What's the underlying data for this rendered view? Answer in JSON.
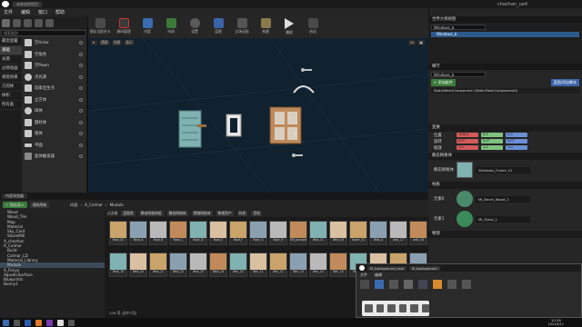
{
  "titlebar": {
    "app_tab": "未命名的项目",
    "user": "chezhan_ue4"
  },
  "menu": [
    "文件",
    "编辑",
    "窗口",
    "帮助"
  ],
  "left_panel": {
    "search_placeholder": "搜索类别",
    "categories": [
      "最近放置",
      "基础",
      "光源",
      "过场动画",
      "视觉效果",
      "几何体",
      "体积",
      "所有类"
    ],
    "items": [
      "空Actor",
      "空角色",
      "空Pawn",
      "点光源",
      "玩家出生点",
      "立方体",
      "球体",
      "圆柱体",
      "锥体",
      "平面",
      "盒体触发器"
    ]
  },
  "toolbar": [
    "保存当前关卡",
    "源码管理",
    "内容",
    "市场",
    "设置",
    "蓝图",
    "过场动画",
    "构建",
    "播放",
    "启动"
  ],
  "viewport": {
    "buttons": [
      "透视",
      "光照",
      "显示"
    ],
    "grid_value": "10"
  },
  "outliner": {
    "title": "世界大纲视图",
    "search": "Windows_b",
    "items": [
      "Windows_b"
    ]
  },
  "details": {
    "title": "细节",
    "actor_name": "Windows_b",
    "add_component": "+ 添加组件",
    "blueprint_button": "蓝图/添加脚本",
    "component": "StaticMeshComponent (StaticMeshComponent0)",
    "sections": {
      "transform": "变换",
      "static_mesh": "静态网格体",
      "materials": "材质",
      "physics": "物理"
    },
    "location_label": "位置",
    "rotation_label": "旋转",
    "scale_label": "缩放",
    "location": [
      "-500.0",
      "0.0",
      "0.0"
    ],
    "rotation": [
      "0.0°",
      "0.0°",
      "0.0°"
    ],
    "scale": [
      "1.0",
      "1.0",
      "1.0"
    ],
    "mesh_label": "静态网格体",
    "mesh_value": "Windows_Frame_01",
    "element0": "元素0",
    "element1": "元素1",
    "mat0": "MI_Bevel_Wood_2",
    "mat1": "MI_Glass_1"
  },
  "content_browser": {
    "tab": "内容浏览器",
    "add_button": "+ 添加/导入",
    "save_button": "保存所有",
    "path": [
      "内容",
      "A_Colmar",
      "Module"
    ],
    "filters_label": "过滤器",
    "filter_tabs": [
      "蓝图类",
      "静态网格体组",
      "静态网格体",
      "骨骼网格体",
      "物理资产",
      "材质",
      "音效"
    ],
    "tree": [
      "Wood",
      "Wood_Tile",
      "Map",
      "Material",
      "Sky_Card",
      "StoneMill",
      "A_chezhan",
      "A_Colmar",
      "Build",
      "Colmar_LD",
      "Material_Library",
      "Module",
      "A_Fenyx",
      "AquaticSurface",
      "Blueprints",
      "Bunny1"
    ],
    "assets": [
      "Roof_02",
      "Roof_A",
      "Roof_B",
      "Roof_C",
      "Roof_D",
      "Roof_E",
      "Roof_F",
      "Roof_G",
      "Roof_H",
      "SM_background",
      "Wall_01",
      "Wall_03",
      "Tower_02",
      "Wall_A",
      "wall_17",
      "wall_18",
      "Wall_19",
      "Wall_20",
      "Wall_21",
      "Wall_22",
      "Wall_23",
      "Wall_24",
      "Win_10",
      "Win_11",
      "Win_12",
      "Win_13",
      "Win_14",
      "Win_15",
      "Win_16",
      "Win_17",
      "Windows_Frame",
      "Windows_b"
    ],
    "status": "126 项 (选中1项)"
  },
  "material_window": {
    "tabs": [
      "M_background_mat",
      "M_background"
    ],
    "menu": [
      "文件",
      "编辑"
    ]
  },
  "taskbar": {
    "time": "10:26",
    "date": "2022/6/11"
  }
}
